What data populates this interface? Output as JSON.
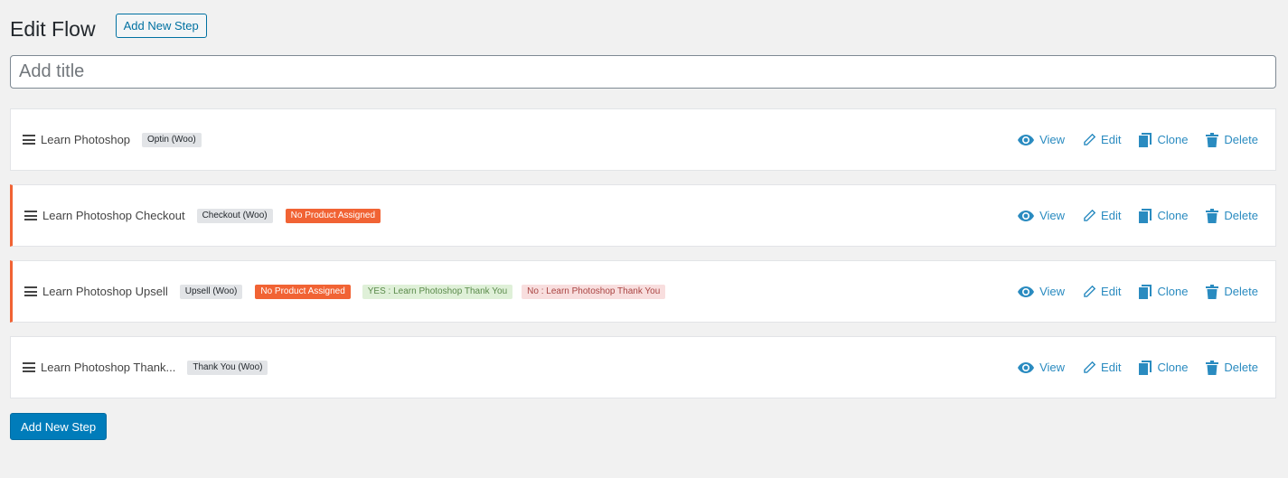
{
  "header": {
    "title": "Edit Flow",
    "add_step_label": "Add New Step"
  },
  "title_input": {
    "placeholder": "Add title",
    "value": ""
  },
  "actions": {
    "view": "View",
    "edit": "Edit",
    "clone": "Clone",
    "delete": "Delete"
  },
  "steps": [
    {
      "name": "Learn Photoshop",
      "type": "Optin (Woo)"
    },
    {
      "name": "Learn Photoshop Checkout",
      "type": "Checkout (Woo)",
      "warning": "No Product Assigned"
    },
    {
      "name": "Learn Photoshop Upsell",
      "type": "Upsell (Woo)",
      "warning": "No Product Assigned",
      "yes": "YES : Learn Photoshop Thank You",
      "no": "No : Learn Photoshop Thank You"
    },
    {
      "name": "Learn Photoshop Thank...",
      "type": "Thank You (Woo)"
    }
  ],
  "footer": {
    "add_step_label": "Add New Step"
  },
  "colors": {
    "accent": "#007cba",
    "link": "#2a8bc0",
    "warning": "#f16334"
  }
}
